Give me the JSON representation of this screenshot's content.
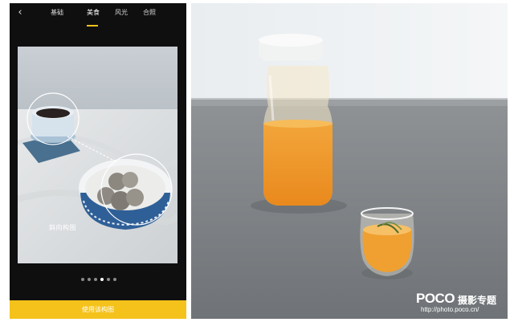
{
  "app": {
    "back_icon": "chevron-left-icon",
    "tabs": [
      {
        "label": "基础",
        "active": false
      },
      {
        "label": "美食",
        "active": true
      },
      {
        "label": "风光",
        "active": false
      },
      {
        "label": "合照",
        "active": false
      }
    ],
    "composition_label": "斜向构图",
    "pagination": {
      "total": 6,
      "current": 4
    },
    "use_button_label": "使用该构图",
    "accent_color": "#f5c21b"
  },
  "watermark": {
    "logo": "POCO",
    "title": "摄影专题",
    "url": "http://photo.poco.cn/"
  }
}
